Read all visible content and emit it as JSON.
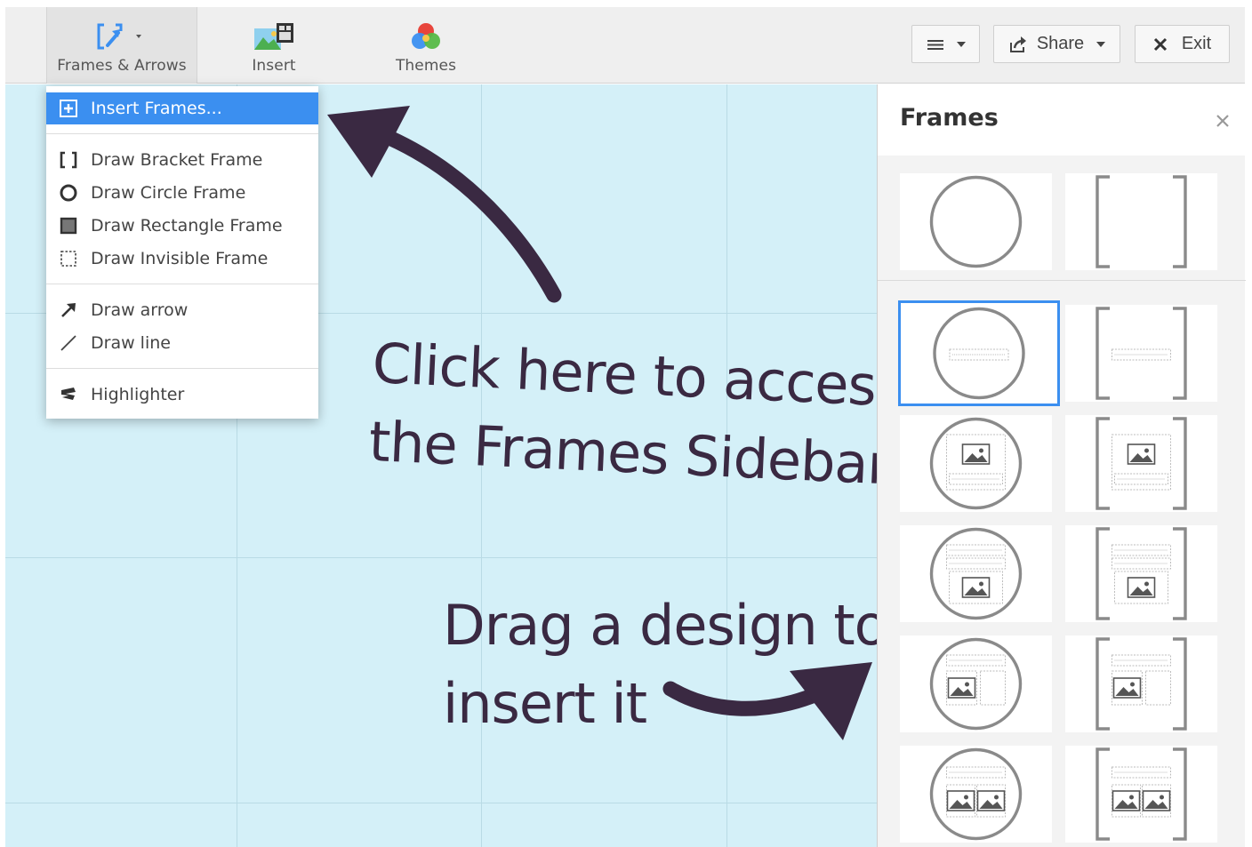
{
  "toolbar": {
    "frames_label": "Frames & Arrows",
    "insert_label": "Insert",
    "themes_label": "Themes",
    "share_label": "Share",
    "exit_label": "Exit"
  },
  "dropdown": {
    "items": [
      {
        "label": "Insert Frames...",
        "icon": "plus-box-icon"
      },
      {
        "label": "Draw Bracket Frame",
        "icon": "bracket-icon"
      },
      {
        "label": "Draw Circle Frame",
        "icon": "circle-icon"
      },
      {
        "label": "Draw Rectangle Frame",
        "icon": "rectangle-icon"
      },
      {
        "label": "Draw Invisible Frame",
        "icon": "dashed-rectangle-icon"
      },
      {
        "label": "Draw arrow",
        "icon": "arrow-icon"
      },
      {
        "label": "Draw line",
        "icon": "line-icon"
      },
      {
        "label": "Highlighter",
        "icon": "highlighter-icon"
      }
    ]
  },
  "canvas": {
    "annotation_1": [
      "Click here to access",
      "the Frames Sidebar"
    ],
    "annotation_2": [
      "Drag a design to",
      "insert it"
    ]
  },
  "sidebar": {
    "title": "Frames",
    "tiles": [
      {
        "shape": "circle",
        "content": "empty"
      },
      {
        "shape": "bracket",
        "content": "empty"
      },
      {
        "shape": "circle",
        "content": "text",
        "selected": true
      },
      {
        "shape": "bracket",
        "content": "text"
      },
      {
        "shape": "circle",
        "content": "image-text"
      },
      {
        "shape": "bracket",
        "content": "image-text"
      },
      {
        "shape": "circle",
        "content": "text-image"
      },
      {
        "shape": "bracket",
        "content": "text-image"
      },
      {
        "shape": "circle",
        "content": "text-image-box"
      },
      {
        "shape": "bracket",
        "content": "text-image-box"
      },
      {
        "shape": "circle",
        "content": "text-two-images"
      },
      {
        "shape": "bracket",
        "content": "text-two-images"
      }
    ]
  },
  "colors": {
    "accent": "#3b8ff0",
    "canvas": "#d4f0f8",
    "annotation": "#3a2942"
  }
}
